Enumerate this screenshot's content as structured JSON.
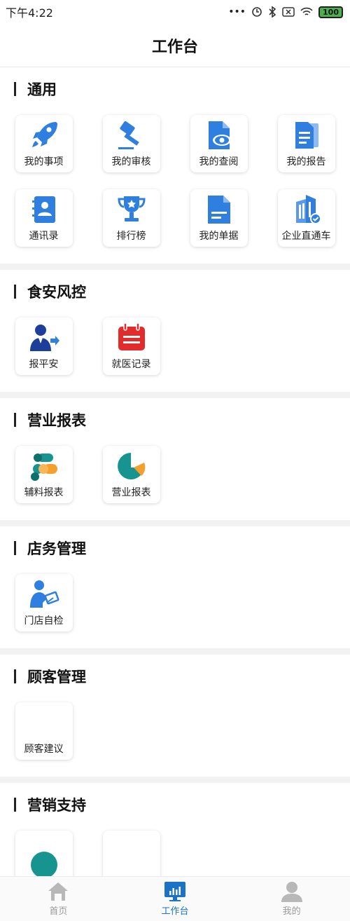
{
  "status": {
    "time": "下午4:22",
    "battery": "100"
  },
  "header": {
    "title": "工作台"
  },
  "sections": [
    {
      "title": "通用",
      "items": [
        {
          "label": "我的事项",
          "icon": "rocket-icon"
        },
        {
          "label": "我的审核",
          "icon": "gavel-icon"
        },
        {
          "label": "我的查阅",
          "icon": "document-eye-icon"
        },
        {
          "label": "我的报告",
          "icon": "report-icon"
        },
        {
          "label": "通讯录",
          "icon": "contacts-icon"
        },
        {
          "label": "排行榜",
          "icon": "trophy-icon"
        },
        {
          "label": "我的单据",
          "icon": "bill-icon"
        },
        {
          "label": "企业直通车",
          "icon": "building-check-icon"
        }
      ]
    },
    {
      "title": "食安风控",
      "items": [
        {
          "label": "报平安",
          "icon": "person-report-icon"
        },
        {
          "label": "就医记录",
          "icon": "calendar-record-icon"
        }
      ]
    },
    {
      "title": "营业报表",
      "items": [
        {
          "label": "辅料报表",
          "icon": "materials-icon"
        },
        {
          "label": "营业报表",
          "icon": "pie-chart-icon"
        }
      ]
    },
    {
      "title": "店务管理",
      "items": [
        {
          "label": "门店自检",
          "icon": "self-check-icon"
        }
      ]
    },
    {
      "title": "顾客管理",
      "items": [
        {
          "label": "顾客建议",
          "icon": ""
        }
      ]
    },
    {
      "title": "营销支持",
      "items": []
    }
  ],
  "tabs": [
    {
      "label": "首页",
      "icon": "home-icon",
      "active": false
    },
    {
      "label": "工作台",
      "icon": "dashboard-icon",
      "active": true
    },
    {
      "label": "我的",
      "icon": "profile-icon",
      "active": false
    }
  ],
  "colors": {
    "primary_blue": "#2f7fe0",
    "tab_active": "#1a73c7",
    "red": "#e32b2b",
    "teal": "#17948f",
    "orange": "#f5a02c"
  }
}
